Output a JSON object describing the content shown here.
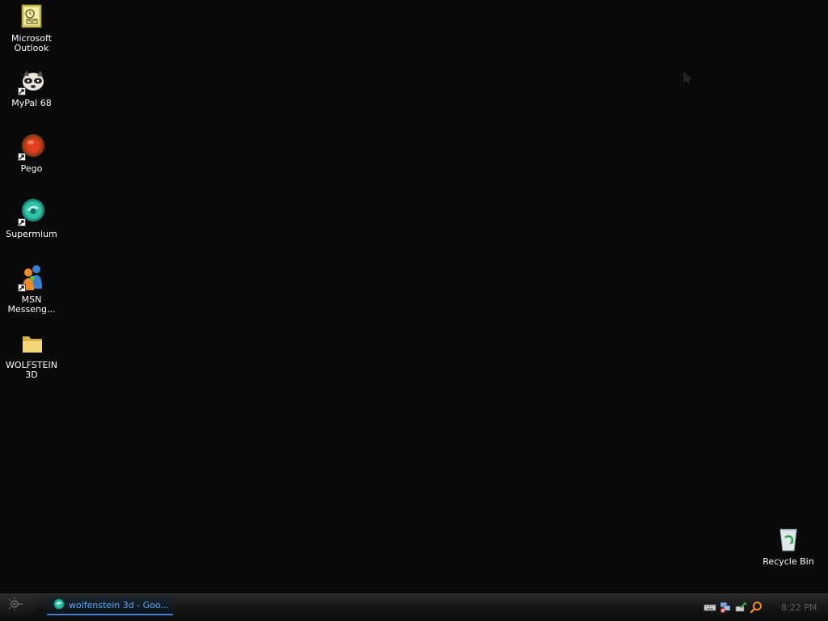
{
  "desktop": {
    "icons": [
      {
        "label": "Microsoft Outlook",
        "icon": "outlook-icon"
      },
      {
        "label": "MyPal 68",
        "icon": "mypal-icon"
      },
      {
        "label": "Pego",
        "icon": "pego-icon"
      },
      {
        "label": "Supermium",
        "icon": "supermium-icon"
      },
      {
        "label": "MSN Messeng...",
        "icon": "msn-messenger-icon"
      },
      {
        "label": "WOLFSTEIN 3D",
        "icon": "folder-icon"
      },
      {
        "label": "Recycle Bin",
        "icon": "recycle-bin-icon"
      }
    ]
  },
  "taskbar": {
    "start_icon": "start-orb-icon",
    "task": {
      "label": "wolfenstein 3d - Goo...",
      "icon": "supermium-icon"
    },
    "tray_icons": [
      "keyboard-icon",
      "network-icon",
      "safely-remove-icon",
      "search-icon"
    ],
    "clock": "8:22 PM"
  },
  "colors": {
    "desktop_background": "#0a0a0a",
    "task_label": "#5aa9ff",
    "task_underline": "#3a7fd5",
    "clock": "#5f5f5f"
  }
}
